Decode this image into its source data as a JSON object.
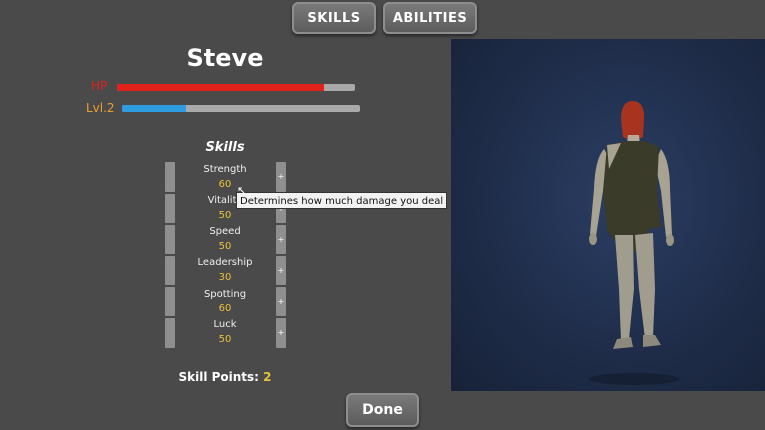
{
  "tabs": {
    "skills": "SKILLS",
    "abilities": "ABILITIES"
  },
  "character": {
    "name": "Steve",
    "hp_label": "HP",
    "hp_fraction": 0.87,
    "hp_color": "#e0221b",
    "level_label": "Lvl.2",
    "xp_fraction": 0.27,
    "xp_color": "#2f9be0",
    "label_color": "#e8a030"
  },
  "skills_panel": {
    "heading": "Skills",
    "items": [
      {
        "name": "Strength",
        "value": "60"
      },
      {
        "name": "Vitality",
        "value": "50"
      },
      {
        "name": "Speed",
        "value": "50"
      },
      {
        "name": "Leadership",
        "value": "30"
      },
      {
        "name": "Spotting",
        "value": "60"
      },
      {
        "name": "Luck",
        "value": "50"
      }
    ],
    "plus_symbol": "+",
    "tooltip": "Determines how much damage you deal",
    "skill_points_label": "Skill Points:",
    "skill_points_value": "2"
  },
  "done_label": "Done"
}
